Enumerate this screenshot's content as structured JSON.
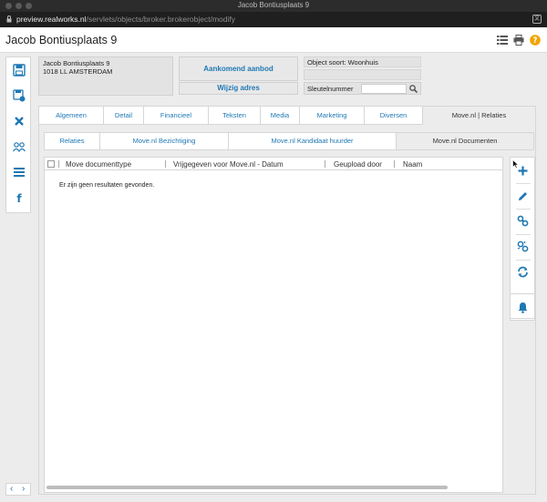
{
  "window": {
    "title": "Jacob Bontiusplaats 9"
  },
  "browser": {
    "url_host": "preview.realworks.nl",
    "url_path": "/servlets/objects/broker.brokerobject/modify"
  },
  "header": {
    "title": "Jacob Bontiusplaats 9",
    "icons": [
      "list-view-icon",
      "print-icon",
      "help-icon"
    ]
  },
  "sidebar": {
    "icons": [
      "save-icon",
      "save-copy-icon",
      "close-icon",
      "contacts-icon",
      "menu-icon",
      "facebook-icon"
    ]
  },
  "address": {
    "line1": "Jacob Bontiusplaats 9",
    "line2": "1018 LL AMSTERDAM"
  },
  "actions": {
    "incoming_bid": "Aankomend aanbod",
    "change_address": "Wijzig adres"
  },
  "object": {
    "type_label": "Object soort: Woonhuis",
    "key_label": "Sleutelnummer",
    "key_value": ""
  },
  "main_tabs": [
    "Algemeen",
    "Detail",
    "Financieel",
    "Teksten",
    "Media",
    "Marketing",
    "Diversen",
    "Move.nl | Relaties"
  ],
  "sub_tabs": [
    "Relaties",
    "Move.nl Bezichtiging",
    "Move.nl Kandidaat huurder",
    "Move.nl Documenten"
  ],
  "grid": {
    "columns": [
      "Move documenttype",
      "Vrijgegeven voor Move.nl - Datum",
      "Geupload door",
      "Naam"
    ],
    "empty_text": "Er zijn geen resultaten gevonden."
  },
  "right_actions": [
    "add-icon",
    "edit-icon",
    "link-icon",
    "unlink-icon",
    "refresh-icon",
    "bell-icon"
  ],
  "pager": {
    "prev": "‹",
    "next": "›"
  },
  "colors": {
    "accent": "#1f78b4",
    "help": "#f0a400"
  }
}
